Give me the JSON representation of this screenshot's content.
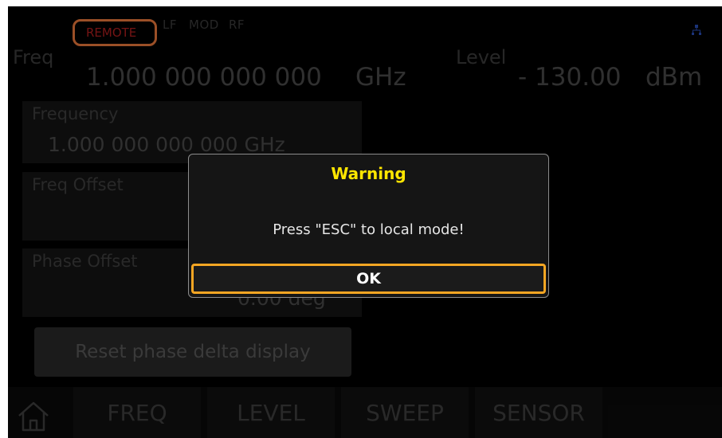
{
  "status_bar": {
    "remote": "REMOTE",
    "lf": "LF",
    "mod": "MOD",
    "rf": "RF",
    "network_icon": "network-icon"
  },
  "header": {
    "freq_label": "Freq",
    "freq_value": "1.000 000 000 000",
    "freq_unit": "GHz",
    "level_label": "Level",
    "level_value": "- 130.00",
    "level_unit": "dBm"
  },
  "panels": {
    "frequency": {
      "label": "Frequency",
      "value": "1.000 000 000 000 GHz"
    },
    "freq_offset": {
      "label": "Freq Offset"
    },
    "phase_offset": {
      "label": "Phase Offset",
      "value": "0.00 deg"
    },
    "reset_button": "Reset phase delta display"
  },
  "nav": {
    "home_icon": "home-icon",
    "tabs": [
      "FREQ",
      "LEVEL",
      "SWEEP",
      "SENSOR"
    ]
  },
  "dialog": {
    "title": "Warning",
    "message": "Press \"ESC\" to local mode!",
    "ok": "OK"
  },
  "colors": {
    "warning_title": "#ffe600",
    "highlight": "#f5a623",
    "remote_ring": "#ef7a3c",
    "remote_text": "#b32020"
  }
}
